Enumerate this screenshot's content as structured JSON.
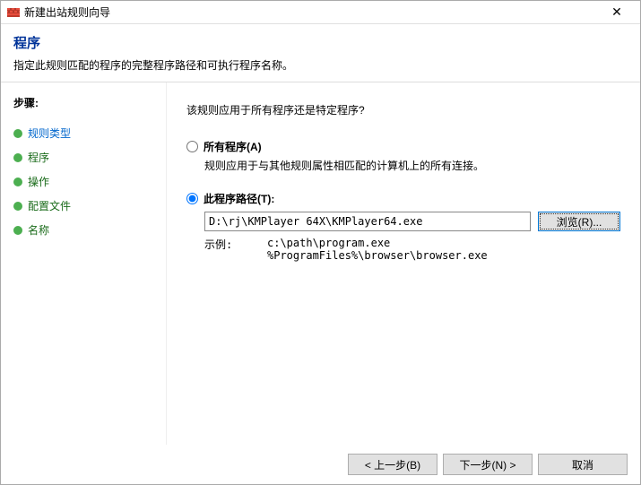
{
  "window": {
    "title": "新建出站规则向导"
  },
  "header": {
    "title": "程序",
    "subtitle": "指定此规则匹配的程序的完整程序路径和可执行程序名称。"
  },
  "sidebar": {
    "heading": "步骤:",
    "items": [
      {
        "label": "规则类型"
      },
      {
        "label": "程序"
      },
      {
        "label": "操作"
      },
      {
        "label": "配置文件"
      },
      {
        "label": "名称"
      }
    ]
  },
  "main": {
    "question": "该规则应用于所有程序还是特定程序?",
    "option_all": {
      "label": "所有程序(A)",
      "desc": "规则应用于与其他规则属性相匹配的计算机上的所有连接。"
    },
    "option_path": {
      "label": "此程序路径(T):",
      "value": "D:\\rj\\KMPlayer 64X\\KMPlayer64.exe",
      "browse": "浏览(R)...",
      "example_label": "示例:",
      "example_text": "c:\\path\\program.exe\n%ProgramFiles%\\browser\\browser.exe"
    }
  },
  "footer": {
    "back": "< 上一步(B)",
    "next": "下一步(N) >",
    "cancel": "取消"
  }
}
